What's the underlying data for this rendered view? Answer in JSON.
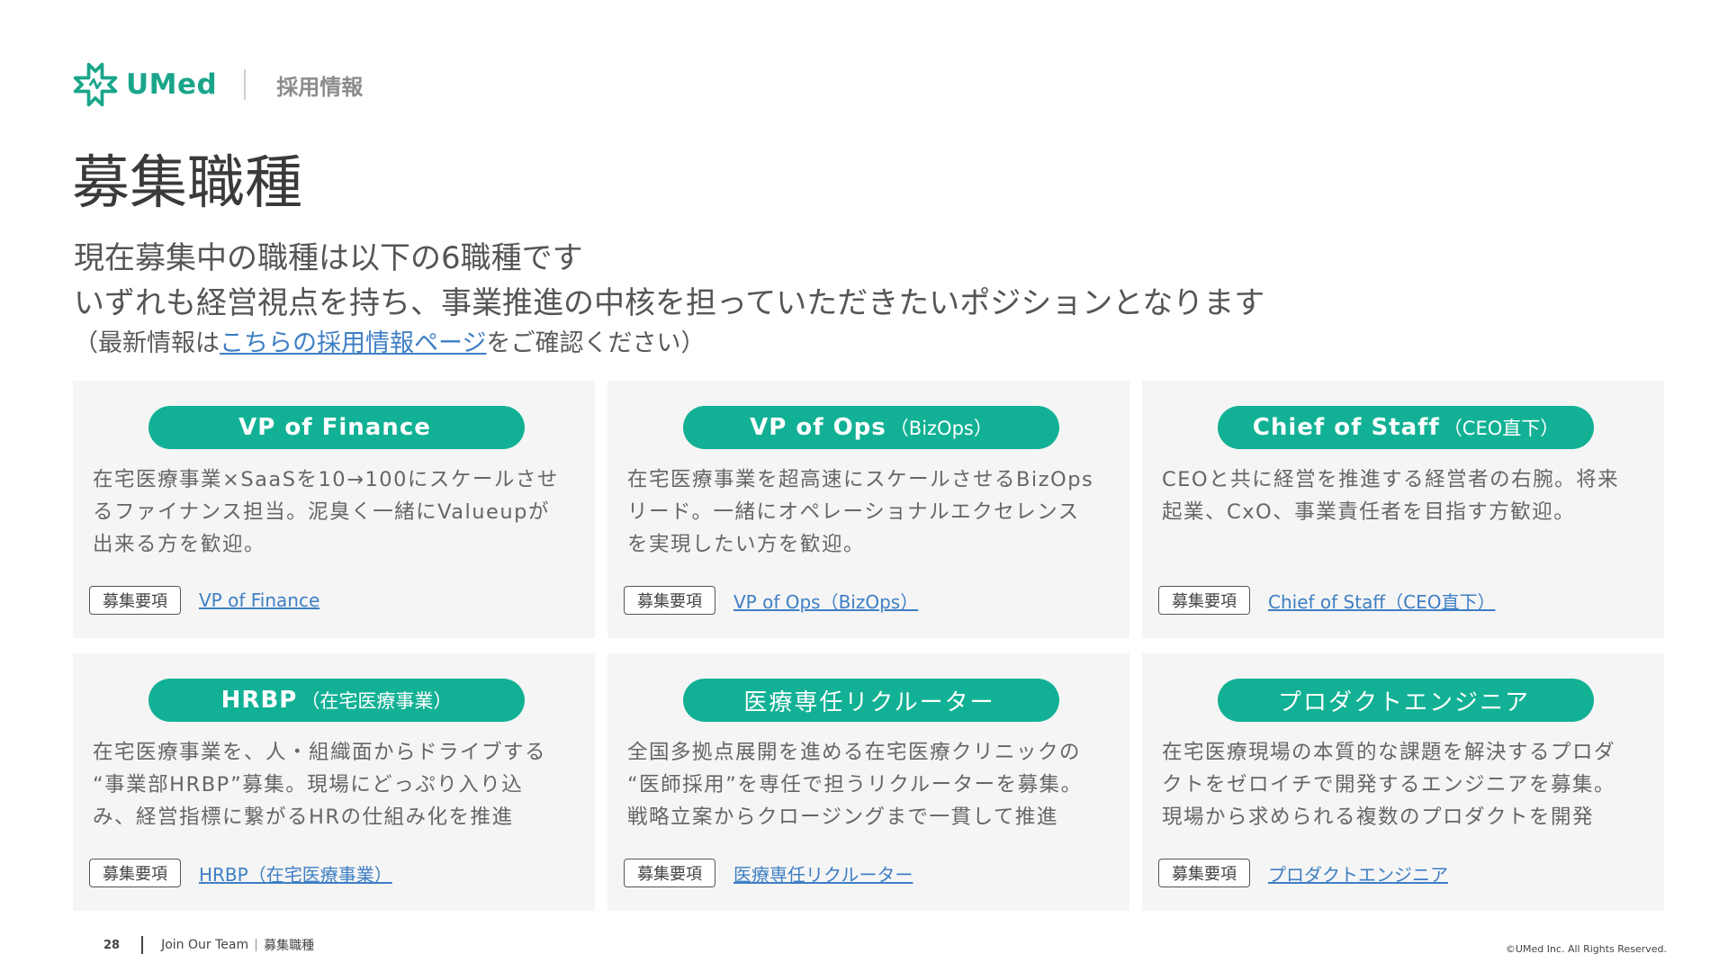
{
  "header": {
    "brand": "UMed",
    "section_label": "採用情報"
  },
  "page_title": "募集職種",
  "lead": {
    "line1": "現在募集中の職種は以下の6職種です",
    "line2": "いずれも経営視点を持ち、事業推進の中核を担っていただきたいポジションとなります",
    "note_prefix": "（最新情報は",
    "note_link": "こちらの採用情報ページ",
    "note_suffix": "をご確認ください）"
  },
  "cards": [
    {
      "title": "VP of Finance",
      "title_sub": "",
      "desc": [
        "在宅医療事業×SaaSを10→100にスケールさせ",
        "るファイナンス担当。泥臭く一緒にValueupが",
        "出来る方を歓迎。"
      ],
      "tag": "募集要項",
      "link": "VP of Finance"
    },
    {
      "title": "VP of Ops",
      "title_sub": "（BizOps）",
      "desc": [
        "在宅医療事業を超高速にスケールさせるBizOps",
        "リード。一緒にオペレーショナルエクセレンス",
        "を実現したい方を歓迎。"
      ],
      "tag": "募集要項",
      "link": "VP of Ops（BizOps）"
    },
    {
      "title": "Chief of Staff",
      "title_sub": "（CEO直下）",
      "desc": [
        "CEOと共に経営を推進する経営者の右腕。将来",
        "起業、CxO、事業責任者を目指す方歓迎。",
        ""
      ],
      "tag": "募集要項",
      "link": "Chief of Staff（CEO直下）"
    },
    {
      "title": "HRBP",
      "title_sub": "（在宅医療事業）",
      "desc": [
        "在宅医療事業を、人・組織面からドライブする",
        "“事業部HRBP”募集。現場にどっぷり入り込",
        "み、経営指標に繋がるHRの仕組み化を推進"
      ],
      "tag": "募集要項",
      "link": "HRBP（在宅医療事業）"
    },
    {
      "title": "医療専任リクルーター",
      "title_sub": "",
      "desc": [
        "全国多拠点展開を進める在宅医療クリニックの",
        "“医師採用”を専任で担うリクルーターを募集。",
        "戦略立案からクロージングまで一貫して推進"
      ],
      "tag": "募集要項",
      "link": "医療専任リクルーター"
    },
    {
      "title": "プロダクトエンジニア",
      "title_sub": "",
      "desc": [
        "在宅医療現場の本質的な課題を解決するプロダ",
        "クトをゼロイチで開発するエンジニアを募集。",
        "現場から求められる複数のプロダクトを開発"
      ],
      "tag": "募集要項",
      "link": "プロダクトエンジニア"
    }
  ],
  "footer": {
    "page_number": "28",
    "deck_title": "Join Our Team",
    "section": "募集職種",
    "copyright": "©UMed Inc. All Rights Reserved."
  },
  "colors": {
    "brand_green": "#1aa58b",
    "pill_green": "#12b195",
    "link_blue": "#3e7fc4",
    "card_bg": "#f5f5f5"
  },
  "icons": {
    "logo": "umed-cross-logo-icon"
  }
}
